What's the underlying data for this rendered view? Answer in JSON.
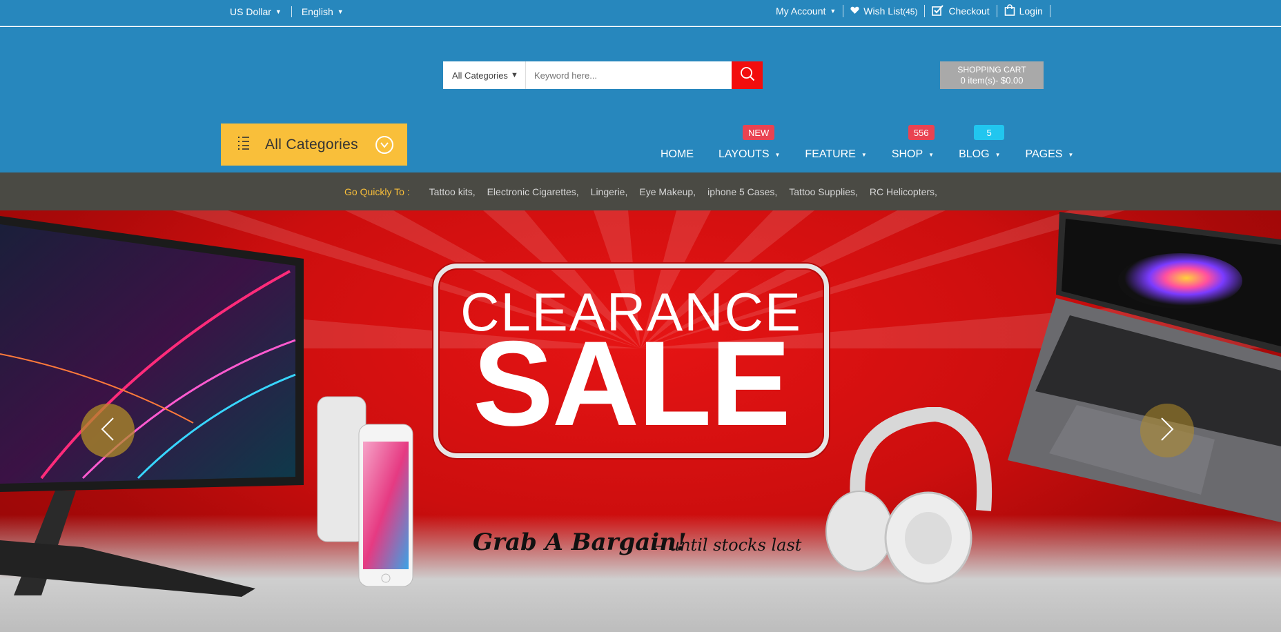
{
  "topbar": {
    "currency": "US Dollar",
    "language": "English",
    "my_account": "My Account",
    "wishlist": "Wish List",
    "wishlist_count": "(45)",
    "checkout": "Checkout",
    "login": "Login"
  },
  "search": {
    "category": "All Categories",
    "placeholder": "Keyword here..."
  },
  "cart": {
    "title": "SHOPPING CART",
    "summary": "0 item(s)- $0.00"
  },
  "all_categories": "All Categories",
  "nav": {
    "items": [
      {
        "label": "HOME"
      },
      {
        "label": "LAYOUTS",
        "badge": "NEW"
      },
      {
        "label": "FEATURE"
      },
      {
        "label": "SHOP",
        "badge": "556"
      },
      {
        "label": "BLOG",
        "badge": "5"
      },
      {
        "label": "PAGES"
      }
    ]
  },
  "quick": {
    "label": "Go Quickly To :",
    "links": [
      "Tattoo kits,",
      "Electronic Cigarettes,",
      "Lingerie,",
      "Eye Makeup,",
      "iphone 5 Cases,",
      "Tattoo Supplies,",
      "RC Helicopters,"
    ]
  },
  "banner": {
    "line1": "CLEARANCE",
    "line2": "SALE",
    "tagline": "Grab A Bargain!",
    "tagline2": "– until stocks last"
  },
  "colors": {
    "header": "#2787bd",
    "accent": "#f9bf3a",
    "search_button": "#f20d0d",
    "badge_red": "#e94352",
    "badge_cyan": "#21c6ef",
    "quickbar": "#4a4a44"
  }
}
